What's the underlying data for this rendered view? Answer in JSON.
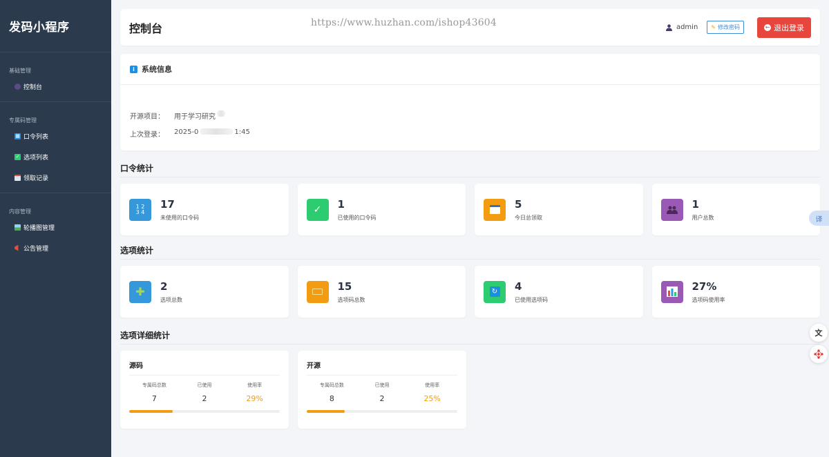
{
  "app": {
    "name": "发码小程序"
  },
  "sidebar": {
    "groups": [
      {
        "title": "基础管理",
        "items": [
          {
            "label": "控制台",
            "icon": "dashboard-icon"
          }
        ]
      },
      {
        "title": "专属码管理",
        "items": [
          {
            "label": "口令列表",
            "icon": "list-icon"
          },
          {
            "label": "选项列表",
            "icon": "check-icon"
          },
          {
            "label": "领取记录",
            "icon": "calendar-icon"
          }
        ]
      },
      {
        "title": "内容管理",
        "items": [
          {
            "label": "轮播图管理",
            "icon": "image-icon"
          },
          {
            "label": "公告管理",
            "icon": "megaphone-icon"
          }
        ]
      }
    ]
  },
  "header": {
    "title": "控制台",
    "watermark": "https://www.huzhan.com/ishop43604",
    "username": "admin",
    "change_password": "修改密码",
    "logout": "退出登录"
  },
  "sysinfo": {
    "title": "系统信息",
    "rows": [
      {
        "key": "开源项目：",
        "value_start": "用于学习研究",
        "value_end": ""
      },
      {
        "key": "上次登录：",
        "value_start": "2025-0",
        "value_end": "1:45"
      }
    ]
  },
  "sections": {
    "token_stats": "口令统计",
    "option_stats": "选项统计",
    "option_detail": "选项详细统计"
  },
  "token_stats": [
    {
      "value": "17",
      "label": "未使用的口令码",
      "color": "#3498db",
      "icon": "numbers-icon"
    },
    {
      "value": "1",
      "label": "已使用的口令码",
      "color": "#2ecc71",
      "icon": "check-icon"
    },
    {
      "value": "5",
      "label": "今日总领取",
      "color": "#f39c12",
      "icon": "calendar-icon"
    },
    {
      "value": "1",
      "label": "用户总数",
      "color": "#9b59b6",
      "icon": "users-icon"
    }
  ],
  "option_stats": [
    {
      "value": "2",
      "label": "选项总数",
      "color": "#3498db",
      "icon": "puzzle-icon"
    },
    {
      "value": "15",
      "label": "选项码总数",
      "color": "#f39c12",
      "icon": "ticket-icon"
    },
    {
      "value": "4",
      "label": "已使用选项码",
      "color": "#2ecc71",
      "icon": "refresh-icon"
    },
    {
      "value": "27%",
      "label": "选项码使用率",
      "color": "#9b59b6",
      "icon": "bar-chart-icon"
    }
  ],
  "option_detail": [
    {
      "name": "源码",
      "col_total": "专属码总数",
      "col_used": "已使用",
      "col_rate": "使用率",
      "total": "7",
      "used": "2",
      "rate": "29%",
      "rate_fraction": 0.29
    },
    {
      "name": "开源",
      "col_total": "专属码总数",
      "col_used": "已使用",
      "col_rate": "使用率",
      "total": "8",
      "used": "2",
      "rate": "25%",
      "rate_fraction": 0.25
    }
  ],
  "floating": {
    "translate": "译"
  }
}
